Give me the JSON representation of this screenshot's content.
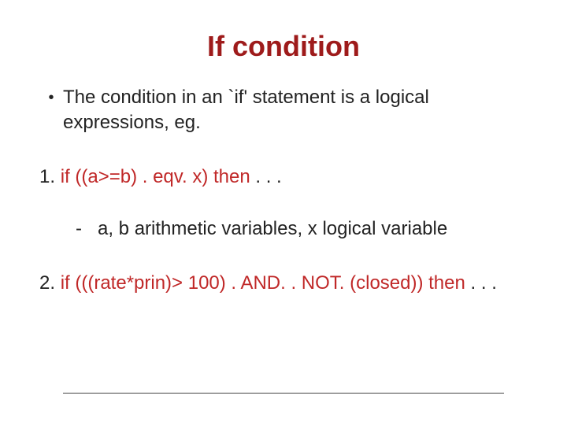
{
  "title": "If condition",
  "bullet1": "The condition in an `if' statement is a logical expressions, eg.",
  "item1": {
    "prefix": "1. ",
    "code": "if ((a>=b) . eqv. x) then",
    "suffix": " . . ."
  },
  "sub1": "a, b arithmetic variables,  x logical variable",
  "item2": {
    "prefix": "2.  ",
    "code": "if (((rate*prin)> 100) . AND. . NOT. (closed)) then",
    "suffix": " . . ."
  }
}
